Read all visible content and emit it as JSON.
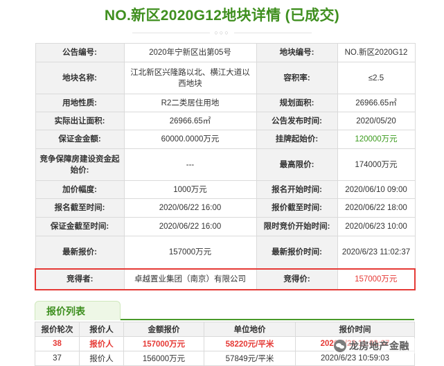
{
  "page_title": "NO.新区2020G12地块详情 (已成交)",
  "divider_text": "○○○",
  "info": {
    "r1": {
      "l1": "公告编号:",
      "v1": "2020年宁新区出第05号",
      "l2": "地块编号:",
      "v2": "NO.新区2020G12"
    },
    "r2": {
      "l1": "地块名称:",
      "v1": "江北新区兴隆路以北、横江大道以西地块",
      "l2": "容积率:",
      "v2": "≤2.5"
    },
    "r3": {
      "l1": "用地性质:",
      "v1": "R2二类居住用地",
      "l2": "规划面积:",
      "v2": "26966.65㎡"
    },
    "r4": {
      "l1": "实际出让面积:",
      "v1": "26966.65㎡",
      "l2": "公告发布时间:",
      "v2": "2020/05/20"
    },
    "r5": {
      "l1": "保证金金额:",
      "v1": "60000.0000万元",
      "l2": "挂牌起始价:",
      "v2": "120000万元"
    },
    "r6": {
      "l1": "竞争保障房建设资金起始价:",
      "v1": "---",
      "l2": "最高限价:",
      "v2": "174000万元"
    },
    "r7": {
      "l1": "加价幅度:",
      "v1": "1000万元",
      "l2": "报名开始时间:",
      "v2": "2020/06/10 09:00"
    },
    "r8": {
      "l1": "报名截至时间:",
      "v1": "2020/06/22 16:00",
      "l2": "报价截至时间:",
      "v2": "2020/06/22 18:00"
    },
    "r9": {
      "l1": "保证金截至时间:",
      "v1": "2020/06/22 16:00",
      "l2": "限时竞价开始时间:",
      "v2": "2020/06/23 10:00"
    },
    "r10": {
      "l1": "最新报价:",
      "v1": "157000万元",
      "l2": "最新报价时间:",
      "v2": "2020/6/23 11:02:37"
    },
    "r11": {
      "l1": "竞得者:",
      "v1": "卓越置业集团（南京）有限公司",
      "l2": "竞得价:",
      "v2": "157000万元"
    }
  },
  "bid_list": {
    "tab_label": "报价列表",
    "headers": [
      "报价轮次",
      "报价人",
      "金额报价",
      "单位地价",
      "报价时间"
    ],
    "rows": [
      [
        "38",
        "报价人",
        "157000万元",
        "58220元/平米",
        "2020/6/23 11:02:37"
      ],
      [
        "37",
        "报价人",
        "156000万元",
        "57849元/平米",
        "2020/6/23 10:59:03"
      ]
    ]
  },
  "watermark": {
    "text": "龙房地产金融",
    "icon": "wechat-icon"
  },
  "colors": {
    "title_green": "#3f8f1f",
    "highlight_red": "#e53935",
    "price_green": "#3a9a1c"
  }
}
